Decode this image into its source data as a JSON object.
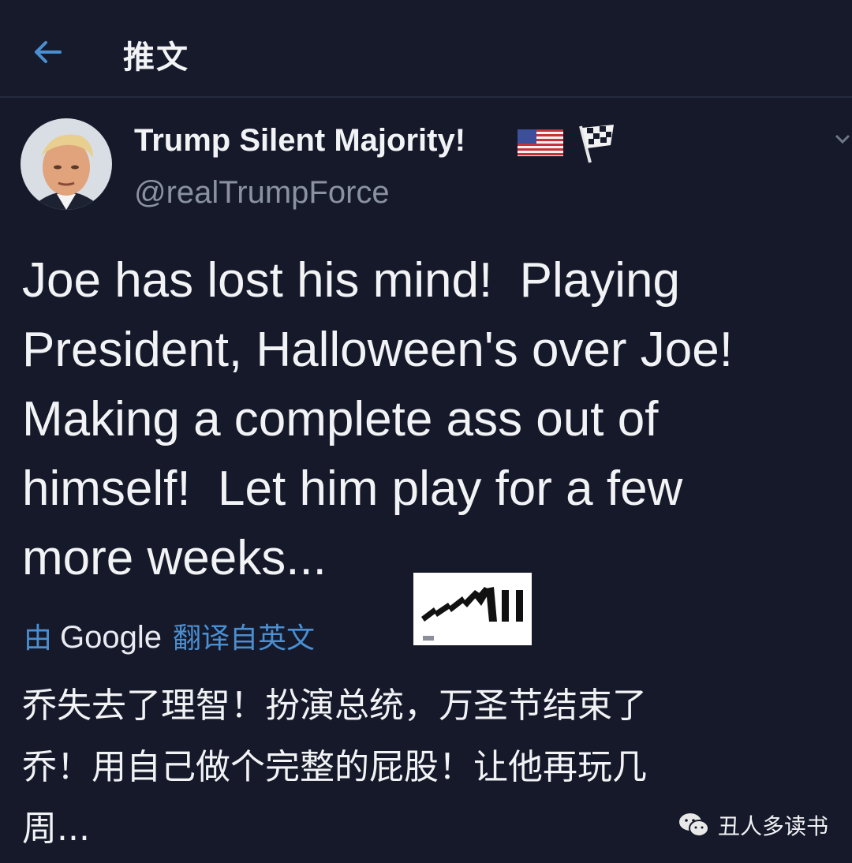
{
  "header": {
    "title": "推文",
    "back_icon": "arrow-left-icon",
    "accent_color": "#4a8fd1"
  },
  "author": {
    "display_name": "Trump Silent Majority!",
    "handle": "@realTrumpForce",
    "badges": [
      "us-flag-icon",
      "checkered-flag-icon"
    ],
    "menu_icon": "chevron-down-icon"
  },
  "tweet": {
    "text": "Joe has lost his mind!  Playing\nPresident, Halloween's over Joe!\nMaking a complete ass out of\nhimself!  Let him play for a few\nmore weeks..."
  },
  "translation": {
    "by_label": "由",
    "provider": "Google",
    "link_label": "翻译自英文",
    "text": "乔失去了理智！扮演总统，万圣节结束了\n乔！用自己做个完整的屁股！让他再玩几\n周..."
  },
  "watermark": {
    "text": "丑人多读书",
    "icon": "wechat-icon"
  }
}
